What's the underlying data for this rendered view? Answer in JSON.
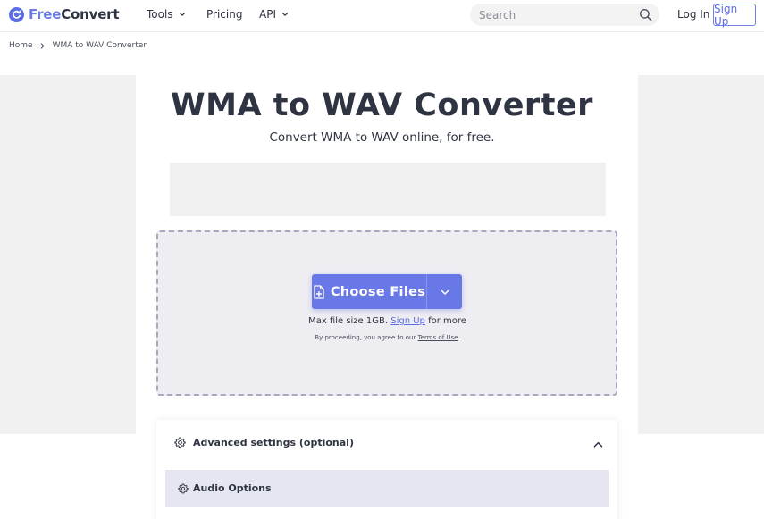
{
  "header": {
    "logo_free": "Free",
    "logo_convert": "Convert",
    "nav": {
      "tools": "Tools",
      "pricing": "Pricing",
      "api": "API"
    },
    "search_placeholder": "Search",
    "login": "Log In",
    "signup": "Sign Up"
  },
  "breadcrumb": {
    "home": "Home",
    "current": "WMA to WAV Converter"
  },
  "main": {
    "title": "WMA to WAV Converter",
    "subtitle": "Convert WMA to WAV online, for free."
  },
  "upload": {
    "choose_label": "Choose Files",
    "limit_prefix": "Max file size 1GB.",
    "limit_link": "Sign Up",
    "limit_suffix": "for more",
    "terms_prefix": "By proceeding, you agree to our",
    "terms_link": "Terms of Use",
    "terms_suffix": "."
  },
  "advanced": {
    "heading": "Advanced settings (optional)",
    "audio_options": "Audio Options"
  },
  "colors": {
    "accent": "#6878e6",
    "brand_dark": "#2f3442"
  },
  "icons": [
    "logo-icon",
    "chevron-down-icon",
    "search-icon",
    "chevron-right-icon",
    "file-plus-icon",
    "gear-icon",
    "chevron-up-icon"
  ]
}
